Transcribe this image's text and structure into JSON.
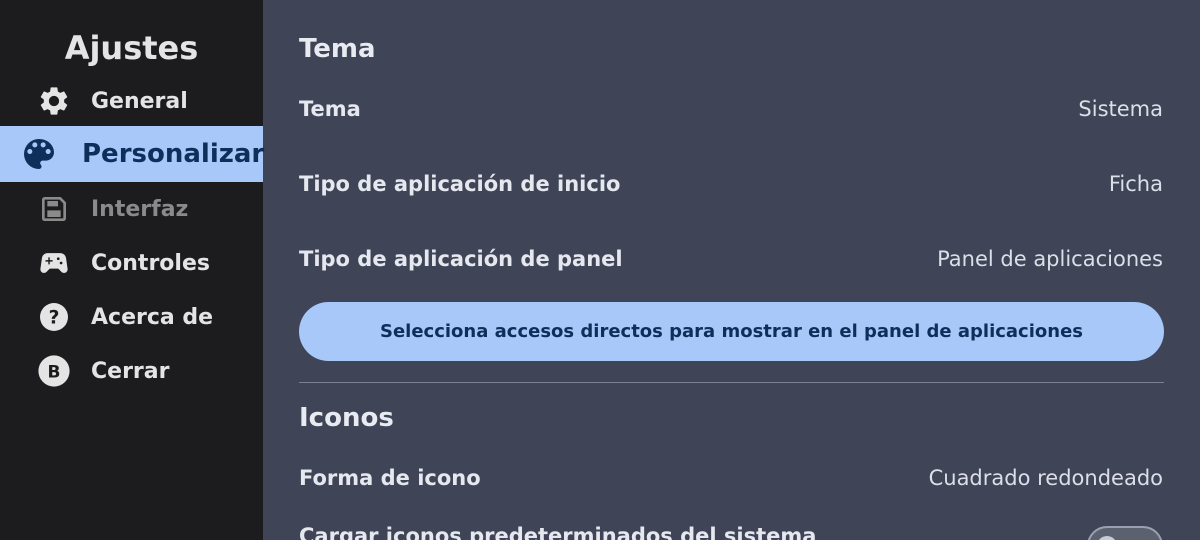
{
  "sidebar": {
    "title": "Ajustes",
    "items": [
      {
        "label": "General",
        "icon": "gear-icon"
      },
      {
        "label": "Personalizar",
        "icon": "palette-icon",
        "active": true
      },
      {
        "label": "Interfaz",
        "icon": "save-icon",
        "disabled": true
      },
      {
        "label": "Controles",
        "icon": "gamepad-icon"
      },
      {
        "label": "Acerca de",
        "icon": "help-icon"
      },
      {
        "label": "Cerrar",
        "icon": "b-button-icon",
        "icon_text": "B"
      }
    ]
  },
  "main": {
    "theme_section": {
      "title": "Tema",
      "rows": [
        {
          "label": "Tema",
          "value": "Sistema"
        },
        {
          "label": "Tipo de aplicación de inicio",
          "value": "Ficha"
        },
        {
          "label": "Tipo de aplicación de panel",
          "value": "Panel de aplicaciones"
        }
      ],
      "shortcuts_button": "Selecciona accesos directos para mostrar en el panel de aplicaciones"
    },
    "icons_section": {
      "title": "Iconos",
      "rows": [
        {
          "label": "Forma de icono",
          "value": "Cuadrado redondeado"
        },
        {
          "label": "Cargar iconos predeterminados del sistema",
          "toggle_on": false
        }
      ]
    }
  },
  "colors": {
    "sidebar_bg": "#1c1c1e",
    "main_bg": "#3f4557",
    "accent": "#a8c8fa",
    "accent_text": "#0d2f5a"
  }
}
